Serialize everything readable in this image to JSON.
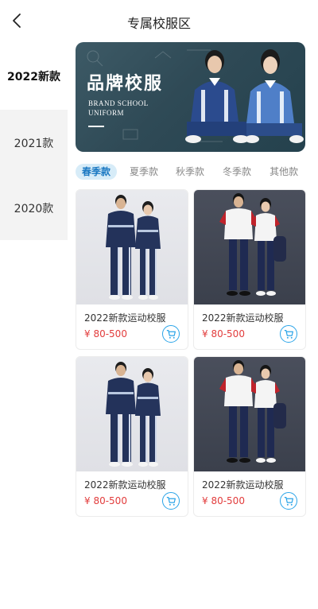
{
  "header": {
    "title": "专属校服区",
    "back_icon": "chevron-left-icon"
  },
  "sidebar": {
    "items": [
      {
        "label": "2022新款",
        "active": true
      },
      {
        "label": "2021款",
        "active": false
      },
      {
        "label": "2020款",
        "active": false
      }
    ]
  },
  "banner": {
    "title": "品牌校服",
    "subtitle_line1": "BRAND SCHOOL",
    "subtitle_line2": "UNIFORM"
  },
  "tabs": [
    {
      "label": "春季款",
      "active": true
    },
    {
      "label": "夏季款",
      "active": false
    },
    {
      "label": "秋季款",
      "active": false
    },
    {
      "label": "冬季款",
      "active": false
    },
    {
      "label": "其他款",
      "active": false
    }
  ],
  "products": [
    {
      "name": "2022新款运动校服",
      "price": "¥ 80-500",
      "image": "tracksuit-photo"
    },
    {
      "name": "2022新款运动校服",
      "price": "¥ 80-500",
      "image": "polo-uniform-photo"
    },
    {
      "name": "2022新款运动校服",
      "price": "¥ 80-500",
      "image": "tracksuit-photo"
    },
    {
      "name": "2022新款运动校服",
      "price": "¥ 80-500",
      "image": "polo-uniform-photo"
    }
  ],
  "colors": {
    "accent": "#1a78c2",
    "tab_active_bg": "#d7ecf8",
    "price": "#e23c3c",
    "cart": "#2aa4e8",
    "sidebar_bg": "#f3f3f3",
    "banner_bg": "#2f4a56"
  }
}
